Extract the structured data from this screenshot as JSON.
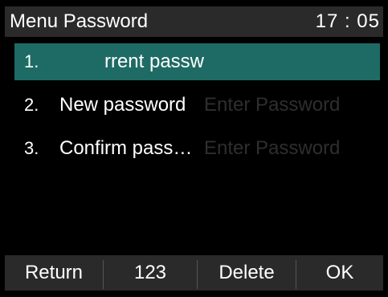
{
  "header": {
    "title": "Menu Password",
    "time": "17 : 05"
  },
  "menu": {
    "items": [
      {
        "number": "1.",
        "label": "Current password",
        "value": "rrent passw",
        "placeholder": ""
      },
      {
        "number": "2.",
        "label": "New password",
        "placeholder": "Enter Password"
      },
      {
        "number": "3.",
        "label": "Confirm password",
        "placeholder": "Enter Password"
      }
    ],
    "selected_index": 0
  },
  "softkeys": {
    "return": "Return",
    "input_mode": "123",
    "delete": "Delete",
    "ok": "OK"
  },
  "colors": {
    "selection": "#1e6b65",
    "bar_background": "#2a2a2a",
    "placeholder": "#2e2e2e"
  }
}
